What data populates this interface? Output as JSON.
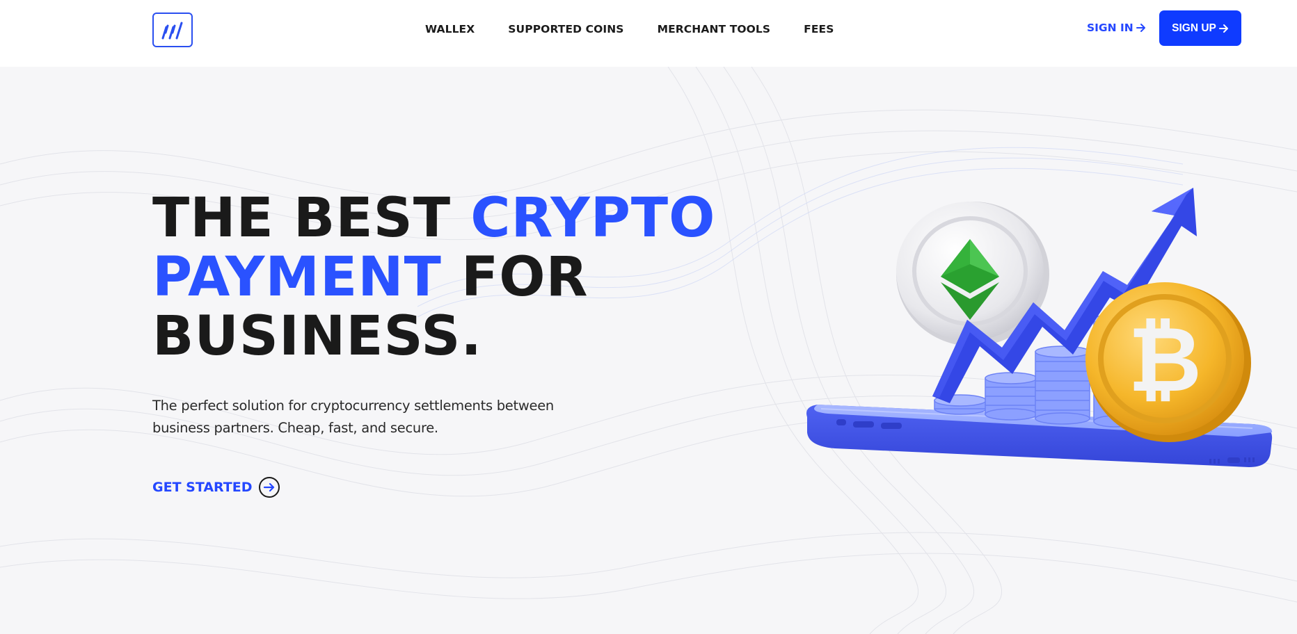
{
  "header": {
    "logo_icon": "wallet-lines-icon",
    "nav": [
      {
        "label": "WALLEX"
      },
      {
        "label": "SUPPORTED COINS"
      },
      {
        "label": "MERCHANT TOOLS"
      },
      {
        "label": "FEES"
      }
    ],
    "sign_in_label": "SIGN IN",
    "sign_up_label": "SIGN UP"
  },
  "hero": {
    "title_line1_dark": "THE BEST ",
    "title_line1_blue": "CRYPTO",
    "title_line2_blue": "PAYMENT",
    "title_line2_dark": " FOR",
    "title_line3_dark": "BUSINESS.",
    "subtitle": "The perfect solution for cryptocurrency settlements between business partners. Cheap, fast, and secure.",
    "cta_label": "GET STARTED",
    "cta_icon": "circle-arrow-right-icon",
    "illustration": "phone-coins-rising-chart"
  },
  "colors": {
    "accent": "#2a52ff",
    "button": "#0f3bff",
    "text": "#1a1a1a",
    "background": "#f6f6f8"
  }
}
